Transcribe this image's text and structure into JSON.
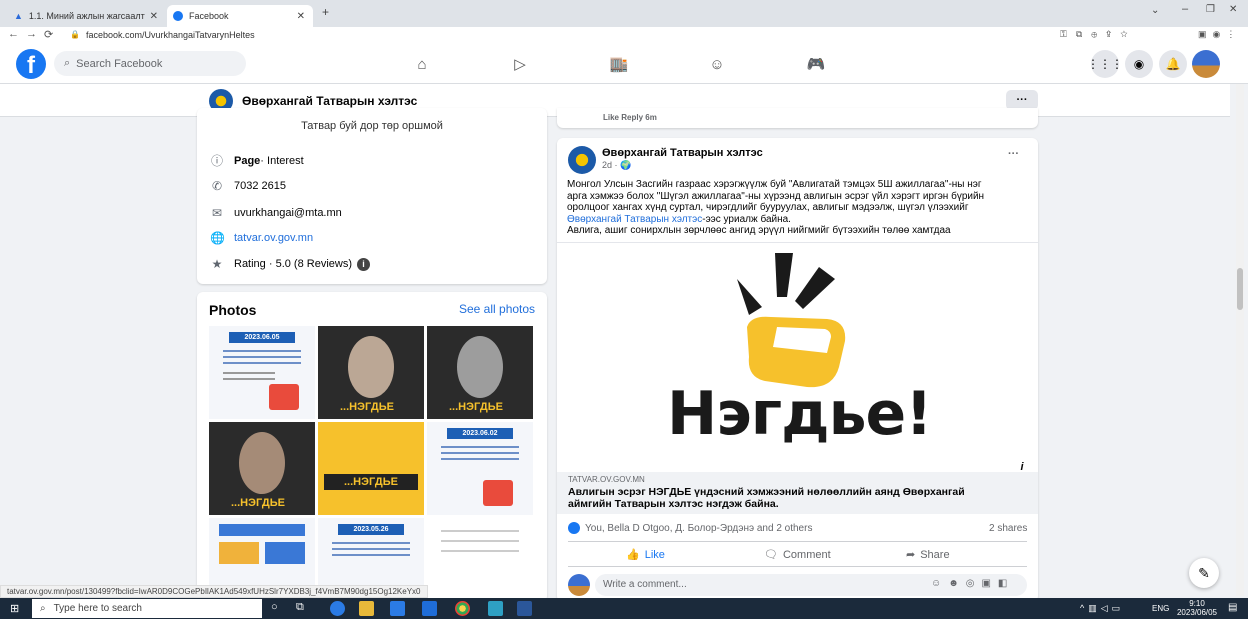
{
  "browser": {
    "tabs": [
      {
        "label": "1.1. Миний ажлын жагсаалт",
        "active": false
      },
      {
        "label": "Facebook",
        "active": true
      }
    ],
    "url": "facebook.com/UvurkhangaiTatvarynHeltes",
    "status_url": "tatvar.ov.gov.mn/post/130499?fbclid=IwAR0D9COGePbIlAK1Ad549xfUHzSlr7YXDB3j_f4VmB7M90dg15Og12KeYx0"
  },
  "header": {
    "search_placeholder": "Search Facebook"
  },
  "page": {
    "name": "Өвөрхангай Татварын хэлтэс",
    "tagline": "Татвар буй дор төр оршмой",
    "info": {
      "category_bold": "Page",
      "category_rest": " · Interest",
      "phone": "7032 2615",
      "email": "uvurkhangai@mta.mn",
      "website": "tatvar.ov.gov.mn",
      "rating": "Rating · 5.0 (8 Reviews)"
    },
    "more_label": "···"
  },
  "photos": {
    "title": "Photos",
    "see_all": "See all photos",
    "tile_date_1": "2023.06.05",
    "tile_date_2": "2023.06.02",
    "tile_date_3": "2023.05.26",
    "tile_caption": "...НЭГДЬЕ"
  },
  "prev_comment": {
    "actions": "Like  Reply  6m"
  },
  "post": {
    "author": "Өвөрхангай Татварын хэлтэс",
    "time": "2d · 🌍",
    "text_lines": [
      "Монгол Улсын Засгийн газраас хэрэгжүүлж буй \"Авлигатай тэмцэх 5Ш ажиллагаа\"-ны нэг",
      "арга хэмжээ болох \"Шүгэл ажиллагаа\"-ны хүрээнд авлигын эсрэг үйл хэрэгт иргэн бүрийн",
      "оролцоог хангах хүнд суртал, чирэгдлийг бууруулах, авлигыг мэдээлж, шүгэл үлээхийг"
    ],
    "mention": "Өвөрхангай Татварын хэлтэс",
    "mention_suffix": "-ээс уриалж байна.",
    "text_last": "Авлига, ашиг сонирхлын зөрчлөөс ангид эрүүл нийгмийг бүтээхийн төлөө хамтдаа",
    "image_word": "Нэгдье!",
    "link_domain": "TATVAR.OV.GOV.MN",
    "link_title_1": "Авлигын эсрэг НЭГДЬЕ үндэсний хэмжээний нөлөөллийн аянд Өвөрхангай",
    "link_title_2": "аймгийн Татварын хэлтэс нэгдэж байна.",
    "reactions": "You, Bella D Otgoo, Д. Болор-Эрдэнэ and 2 others",
    "shares": "2 shares",
    "like_label": "Like",
    "comment_label": "Comment",
    "share_label": "Share",
    "comment_placeholder": "Write a comment..."
  },
  "taskbar": {
    "search_placeholder": "Type here to search",
    "lang": "ENG",
    "time": "9:10",
    "date": "2023/06/05"
  }
}
